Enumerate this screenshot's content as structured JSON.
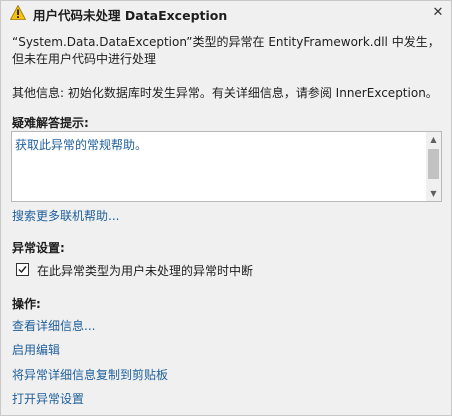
{
  "window": {
    "title": "用户代码未处理 DataException",
    "close_glyph": "✕"
  },
  "message": {
    "main": "“System.Data.DataException”类型的异常在 EntityFramework.dll 中发生，但未在用户代码中进行处理",
    "extra": "其他信息: 初始化数据库时发生异常。有关详细信息，请参阅 InnerException。"
  },
  "troubleshooting": {
    "label": "疑难解答提示:",
    "tip_link": "获取此异常的常规帮助。",
    "search_online": "搜索更多联机帮助..."
  },
  "exception_settings": {
    "label": "异常设置:",
    "break_checkbox": {
      "label": "在此异常类型为用户未处理的异常时中断",
      "checked": true
    }
  },
  "actions": {
    "label": "操作:",
    "items": [
      "查看详细信息...",
      "启用编辑",
      "将异常详细信息复制到剪贴板",
      "打开异常设置"
    ]
  },
  "colors": {
    "link": "#1f5f9a",
    "warning_icon": "#f4c20d"
  }
}
